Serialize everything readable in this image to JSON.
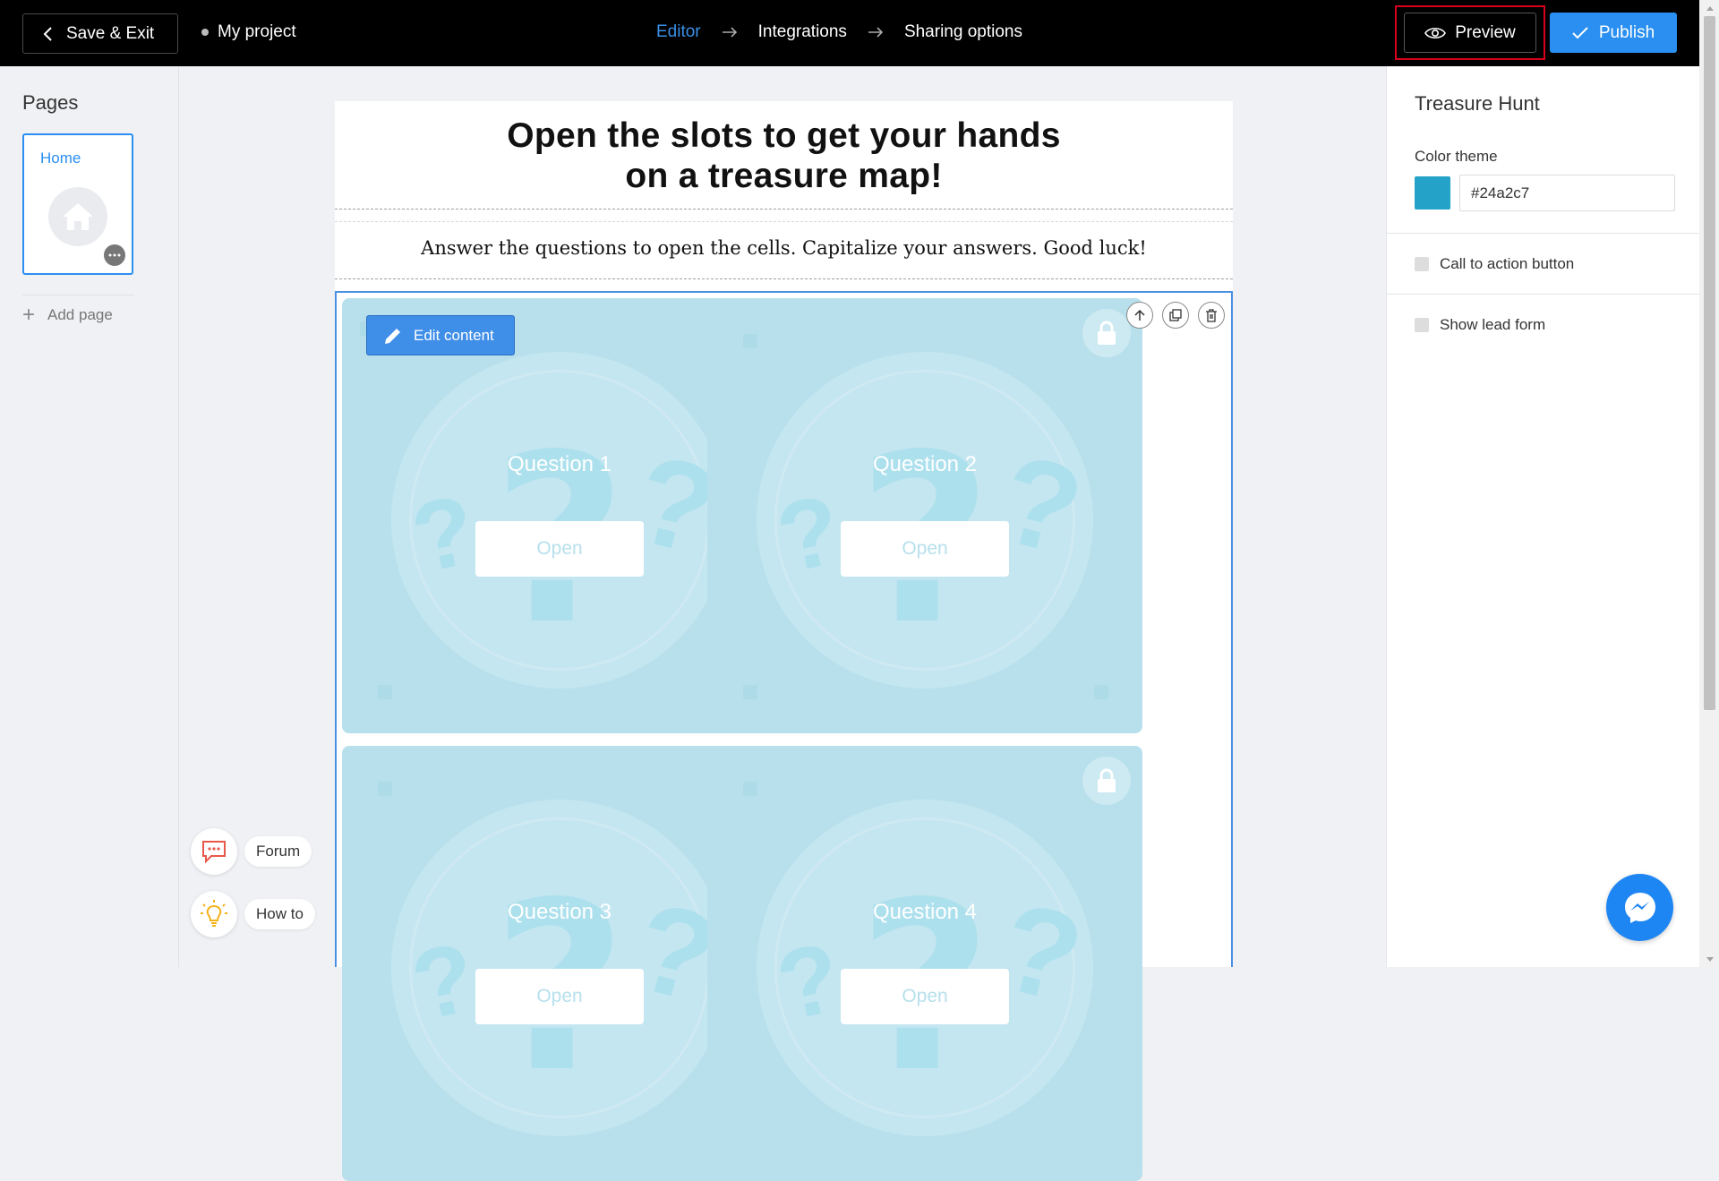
{
  "topbar": {
    "save_exit_label": "Save & Exit",
    "project_name": "My project",
    "steps": [
      "Editor",
      "Integrations",
      "Sharing options"
    ],
    "active_step": "Editor",
    "preview_label": "Preview",
    "publish_label": "Publish"
  },
  "sidebar": {
    "title": "Pages",
    "pages": [
      {
        "label": "Home",
        "icon": "home-icon"
      }
    ],
    "add_page_label": "Add page"
  },
  "help": {
    "forum_label": "Forum",
    "howto_label": "How to"
  },
  "canvas": {
    "headline_line1": "Open the slots to get your hands",
    "headline_line2": "on a treasure map!",
    "subtitle": "Answer the questions to open the cells. Capitalize your answers. Good luck!",
    "edit_content_label": "Edit content",
    "cells": [
      {
        "label": "Question 1",
        "button": "Open"
      },
      {
        "label": "Question 2",
        "button": "Open"
      },
      {
        "label": "Question 3",
        "button": "Open"
      },
      {
        "label": "Question 4",
        "button": "Open"
      }
    ]
  },
  "panel": {
    "title": "Treasure Hunt",
    "color_theme_label": "Color theme",
    "color_value": "#24a2c7",
    "cta_label": "Call to action button",
    "lead_form_label": "Show lead form"
  },
  "colors": {
    "accent": "#2a8ff0",
    "theme": "#24a2c7",
    "cell_bg": "#b7e0ec",
    "highlight": "#d6001c"
  }
}
